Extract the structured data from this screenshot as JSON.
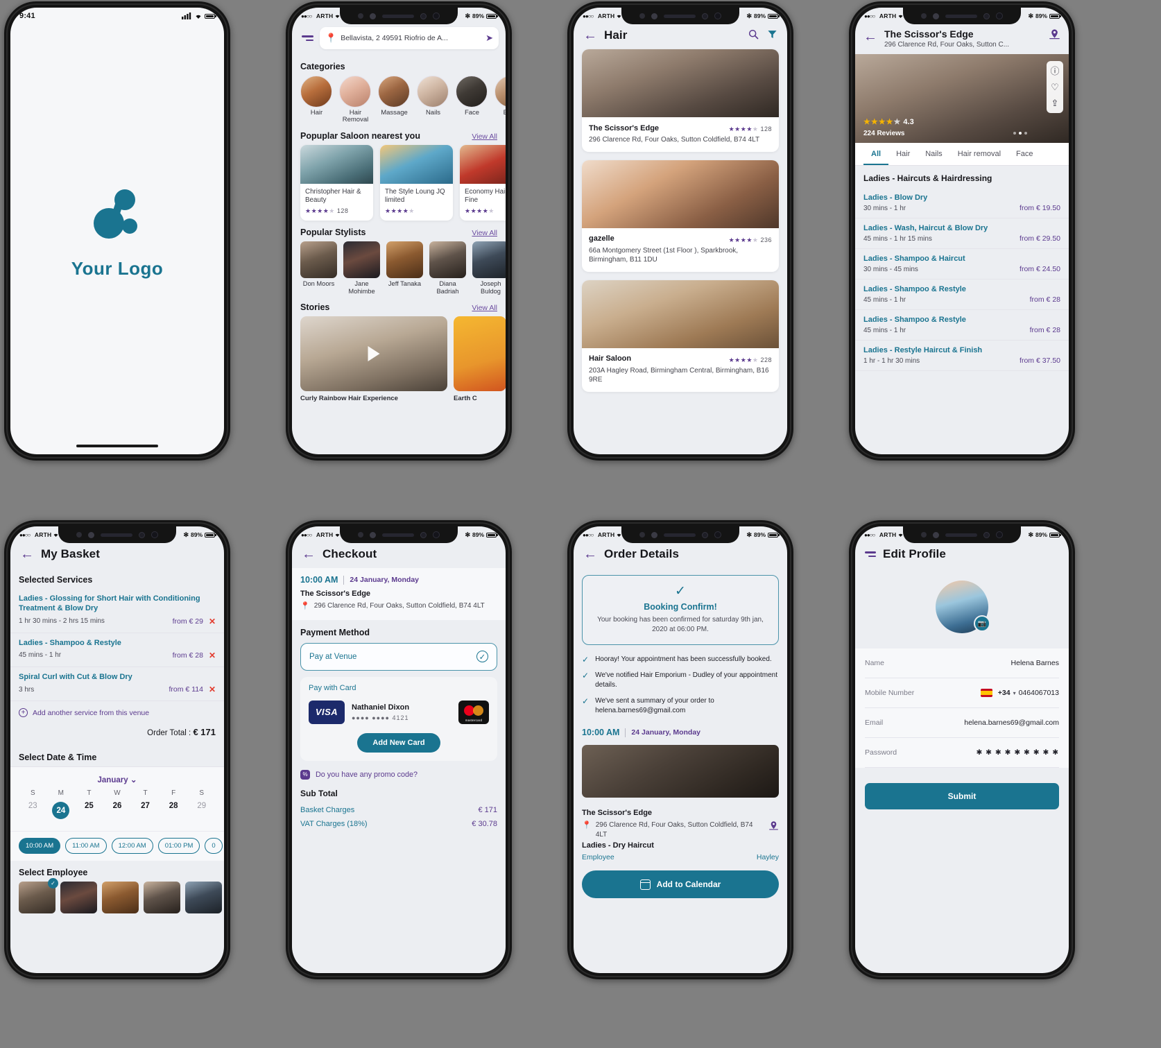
{
  "status_bar": {
    "carrier": "ARTH",
    "battery": "89%",
    "time_first_screen": "9:41"
  },
  "screen1_splash": {
    "logo_text": "Your Logo"
  },
  "screen2_home": {
    "address": "Bellavista, 2 49591 Riofrio de A...",
    "categories_title": "Categories",
    "categories": [
      {
        "label": "Hair"
      },
      {
        "label": "Hair Removal"
      },
      {
        "label": "Massage"
      },
      {
        "label": "Nails"
      },
      {
        "label": "Face"
      },
      {
        "label": "Body"
      }
    ],
    "salons_title": "Popuplar Saloon nearest you",
    "view_all": "View All",
    "salons": [
      {
        "name": "Christopher Hair & Beauty",
        "stars": 4,
        "count": "128"
      },
      {
        "name": "The Style Loung JQ limited",
        "stars": 4,
        "count": ""
      },
      {
        "name": "Economy Hair and Fine",
        "stars": 4,
        "count": ""
      }
    ],
    "stylists_title": "Popular Stylists",
    "stylists": [
      {
        "name": "Don Moors"
      },
      {
        "name": "Jane Mohimbe"
      },
      {
        "name": "Jeff Tanaka"
      },
      {
        "name": "Diana Badriah"
      },
      {
        "name": "Joseph Buldog"
      }
    ],
    "stories_title": "Stories",
    "stories": [
      {
        "caption": "Curly Rainbow Hair Experience"
      },
      {
        "caption": "Earth C"
      }
    ]
  },
  "screen3_hair": {
    "title": "Hair",
    "search_icon": "search-icon",
    "filter_icon": "filter-icon",
    "venues": [
      {
        "name": "The Scissor's Edge",
        "address": "296 Clarence Rd, Four Oaks, Sutton Coldfield, B74 4LT",
        "stars": 4,
        "count": "128"
      },
      {
        "name": "gazelle",
        "address": "66a Montgomery Street (1st Floor ), Sparkbrook, Birmingham, B11 1DU",
        "stars": 4,
        "count": "236"
      },
      {
        "name": "Hair Saloon",
        "address": "203A Hagley Road, Birmingham Central, Birmingham, B16 9RE",
        "stars": 4,
        "count": "228"
      }
    ]
  },
  "screen4_venue": {
    "title": "The Scissor's Edge",
    "address": "296 Clarence Rd, Four Oaks, Sutton C...",
    "rating": "4.3",
    "reviews": "224 Reviews",
    "rail_icons": [
      "info-icon",
      "heart-icon",
      "share-icon"
    ],
    "tabs": [
      "All",
      "Hair",
      "Nails",
      "Hair removal",
      "Face"
    ],
    "active_tab": "All",
    "group_title": "Ladies - Haircuts & Hairdressing",
    "services": [
      {
        "name": "Ladies - Blow Dry",
        "duration": "30 mins - 1 hr",
        "price": "from € 19.50"
      },
      {
        "name": "Ladies - Wash, Haircut & Blow Dry",
        "duration": "45 mins - 1 hr 15 mins",
        "price": "from € 29.50"
      },
      {
        "name": "Ladies - Shampoo & Haircut",
        "duration": "30 mins - 45 mins",
        "price": "from € 24.50"
      },
      {
        "name": "Ladies - Shampoo & Restyle",
        "duration": "45 mins - 1 hr",
        "price": "from € 28"
      },
      {
        "name": "Ladies - Shampoo & Restyle",
        "duration": "45 mins - 1 hr",
        "price": "from € 28"
      },
      {
        "name": "Ladies - Restyle Haircut & Finish",
        "duration": "1 hr - 1 hr 30 mins",
        "price": "from € 37.50"
      }
    ]
  },
  "screen5_basket": {
    "title": "My Basket",
    "section_services": "Selected Services",
    "items": [
      {
        "name": "Ladies - Glossing for Short Hair with Conditioning Treatment & Blow Dry",
        "duration": "1 hr 30 mins - 2 hrs 15 mins",
        "price": "from € 29"
      },
      {
        "name": "Ladies - Shampoo & Restyle",
        "duration": "45 mins - 1 hr",
        "price": "from € 28"
      },
      {
        "name": "Spiral Curl with Cut & Blow Dry",
        "duration": "3 hrs",
        "price": "from € 114"
      }
    ],
    "add_service": "Add another service from this venue",
    "order_total_label": "Order Total :",
    "order_total_value": "€ 171",
    "section_datetime": "Select Date & Time",
    "month": "January",
    "dow": [
      "S",
      "M",
      "T",
      "W",
      "T",
      "F",
      "S"
    ],
    "days": [
      "23",
      "24",
      "25",
      "26",
      "27",
      "28",
      "29"
    ],
    "selected_day": "24",
    "times": [
      "10:00 AM",
      "11:00 AM",
      "12:00 AM",
      "01:00 PM",
      "0"
    ],
    "selected_time": "10:00 AM",
    "section_employee": "Select Employee"
  },
  "screen6_checkout": {
    "title": "Checkout",
    "time": "10:00 AM",
    "date": "24 January, Monday",
    "venue_name": "The Scissor's Edge",
    "venue_address": "296 Clarence Rd, Four Oaks, Sutton Coldfield, B74 4LT",
    "payment_title": "Payment Method",
    "pay_at_venue": "Pay at Venue",
    "pay_with_card": "Pay with Card",
    "card_brand": "VISA",
    "card_holder": "Nathaniel Dixon",
    "card_mask": "●●●● ●●●●",
    "card_last4": "4121",
    "mastercard_label": "mastercard",
    "add_new_card": "Add New Card",
    "promo": "Do you have any promo code?",
    "sub_total_title": "Sub Total",
    "fees": [
      {
        "label": "Basket Charges",
        "value": "€ 171"
      },
      {
        "label": "VAT Charges (18%)",
        "value": "€ 30.78"
      }
    ]
  },
  "screen7_order": {
    "title": "Order Details",
    "confirm_title": "Booking Confirm!",
    "confirm_text": "Your booking has been confirmed for saturday 9th jan, 2020 at 06:00 PM.",
    "checks": [
      "Hooray! Your appointment has been successfully booked.",
      "We've notified Hair Emporium - Dudley of your appointment details.",
      "We've sent a summary of your order to helena.barnes69@gmail.com"
    ],
    "time": "10:00 AM",
    "date": "24 January, Monday",
    "venue_name": "The Scissor's Edge",
    "venue_address": "296 Clarence Rd, Four Oaks, Sutton Coldfield, B74 4LT",
    "service": "Ladies - Dry Haircut",
    "employee_label": "Employee",
    "employee_name": "Hayley",
    "add_to_calendar": "Add to Calendar"
  },
  "screen8_profile": {
    "title": "Edit Profile",
    "fields": [
      {
        "label": "Name",
        "value": "Helena Barnes"
      },
      {
        "label": "Mobile Number",
        "value": "0464067013",
        "country_code": "+34"
      },
      {
        "label": "Email",
        "value": "helena.barnes69@gmail.com"
      },
      {
        "label": "Password",
        "value": "✱ ✱ ✱ ✱ ✱ ✱ ✱ ✱ ✱"
      }
    ],
    "submit": "Submit"
  }
}
